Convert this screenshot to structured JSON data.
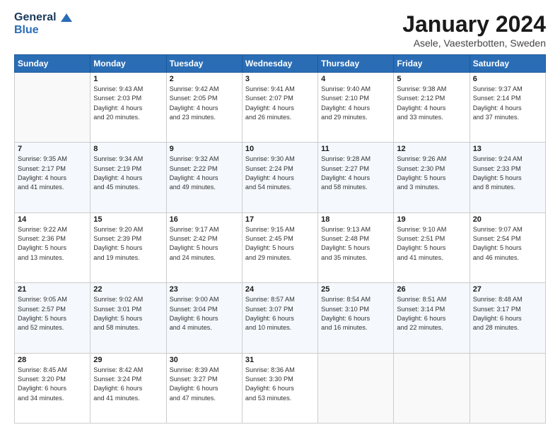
{
  "logo": {
    "line1": "General",
    "line2": "Blue"
  },
  "header": {
    "title": "January 2024",
    "subtitle": "Asele, Vaesterbotten, Sweden"
  },
  "weekdays": [
    "Sunday",
    "Monday",
    "Tuesday",
    "Wednesday",
    "Thursday",
    "Friday",
    "Saturday"
  ],
  "weeks": [
    [
      {
        "day": "",
        "info": ""
      },
      {
        "day": "1",
        "info": "Sunrise: 9:43 AM\nSunset: 2:03 PM\nDaylight: 4 hours\nand 20 minutes."
      },
      {
        "day": "2",
        "info": "Sunrise: 9:42 AM\nSunset: 2:05 PM\nDaylight: 4 hours\nand 23 minutes."
      },
      {
        "day": "3",
        "info": "Sunrise: 9:41 AM\nSunset: 2:07 PM\nDaylight: 4 hours\nand 26 minutes."
      },
      {
        "day": "4",
        "info": "Sunrise: 9:40 AM\nSunset: 2:10 PM\nDaylight: 4 hours\nand 29 minutes."
      },
      {
        "day": "5",
        "info": "Sunrise: 9:38 AM\nSunset: 2:12 PM\nDaylight: 4 hours\nand 33 minutes."
      },
      {
        "day": "6",
        "info": "Sunrise: 9:37 AM\nSunset: 2:14 PM\nDaylight: 4 hours\nand 37 minutes."
      }
    ],
    [
      {
        "day": "7",
        "info": "Sunrise: 9:35 AM\nSunset: 2:17 PM\nDaylight: 4 hours\nand 41 minutes."
      },
      {
        "day": "8",
        "info": "Sunrise: 9:34 AM\nSunset: 2:19 PM\nDaylight: 4 hours\nand 45 minutes."
      },
      {
        "day": "9",
        "info": "Sunrise: 9:32 AM\nSunset: 2:22 PM\nDaylight: 4 hours\nand 49 minutes."
      },
      {
        "day": "10",
        "info": "Sunrise: 9:30 AM\nSunset: 2:24 PM\nDaylight: 4 hours\nand 54 minutes."
      },
      {
        "day": "11",
        "info": "Sunrise: 9:28 AM\nSunset: 2:27 PM\nDaylight: 4 hours\nand 58 minutes."
      },
      {
        "day": "12",
        "info": "Sunrise: 9:26 AM\nSunset: 2:30 PM\nDaylight: 5 hours\nand 3 minutes."
      },
      {
        "day": "13",
        "info": "Sunrise: 9:24 AM\nSunset: 2:33 PM\nDaylight: 5 hours\nand 8 minutes."
      }
    ],
    [
      {
        "day": "14",
        "info": "Sunrise: 9:22 AM\nSunset: 2:36 PM\nDaylight: 5 hours\nand 13 minutes."
      },
      {
        "day": "15",
        "info": "Sunrise: 9:20 AM\nSunset: 2:39 PM\nDaylight: 5 hours\nand 19 minutes."
      },
      {
        "day": "16",
        "info": "Sunrise: 9:17 AM\nSunset: 2:42 PM\nDaylight: 5 hours\nand 24 minutes."
      },
      {
        "day": "17",
        "info": "Sunrise: 9:15 AM\nSunset: 2:45 PM\nDaylight: 5 hours\nand 29 minutes."
      },
      {
        "day": "18",
        "info": "Sunrise: 9:13 AM\nSunset: 2:48 PM\nDaylight: 5 hours\nand 35 minutes."
      },
      {
        "day": "19",
        "info": "Sunrise: 9:10 AM\nSunset: 2:51 PM\nDaylight: 5 hours\nand 41 minutes."
      },
      {
        "day": "20",
        "info": "Sunrise: 9:07 AM\nSunset: 2:54 PM\nDaylight: 5 hours\nand 46 minutes."
      }
    ],
    [
      {
        "day": "21",
        "info": "Sunrise: 9:05 AM\nSunset: 2:57 PM\nDaylight: 5 hours\nand 52 minutes."
      },
      {
        "day": "22",
        "info": "Sunrise: 9:02 AM\nSunset: 3:01 PM\nDaylight: 5 hours\nand 58 minutes."
      },
      {
        "day": "23",
        "info": "Sunrise: 9:00 AM\nSunset: 3:04 PM\nDaylight: 6 hours\nand 4 minutes."
      },
      {
        "day": "24",
        "info": "Sunrise: 8:57 AM\nSunset: 3:07 PM\nDaylight: 6 hours\nand 10 minutes."
      },
      {
        "day": "25",
        "info": "Sunrise: 8:54 AM\nSunset: 3:10 PM\nDaylight: 6 hours\nand 16 minutes."
      },
      {
        "day": "26",
        "info": "Sunrise: 8:51 AM\nSunset: 3:14 PM\nDaylight: 6 hours\nand 22 minutes."
      },
      {
        "day": "27",
        "info": "Sunrise: 8:48 AM\nSunset: 3:17 PM\nDaylight: 6 hours\nand 28 minutes."
      }
    ],
    [
      {
        "day": "28",
        "info": "Sunrise: 8:45 AM\nSunset: 3:20 PM\nDaylight: 6 hours\nand 34 minutes."
      },
      {
        "day": "29",
        "info": "Sunrise: 8:42 AM\nSunset: 3:24 PM\nDaylight: 6 hours\nand 41 minutes."
      },
      {
        "day": "30",
        "info": "Sunrise: 8:39 AM\nSunset: 3:27 PM\nDaylight: 6 hours\nand 47 minutes."
      },
      {
        "day": "31",
        "info": "Sunrise: 8:36 AM\nSunset: 3:30 PM\nDaylight: 6 hours\nand 53 minutes."
      },
      {
        "day": "",
        "info": ""
      },
      {
        "day": "",
        "info": ""
      },
      {
        "day": "",
        "info": ""
      }
    ]
  ]
}
